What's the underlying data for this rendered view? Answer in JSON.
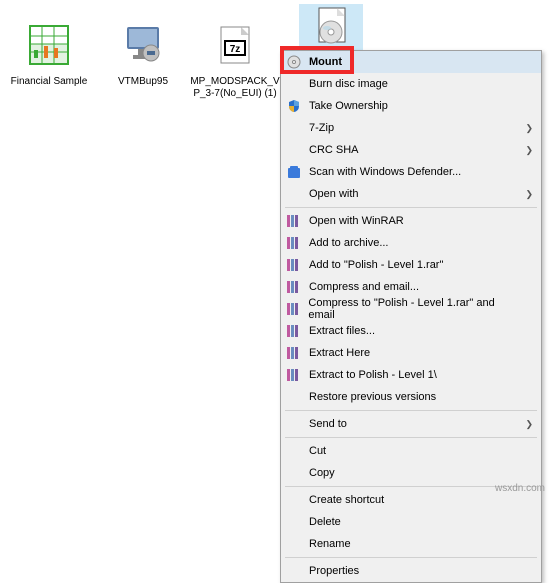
{
  "files": [
    {
      "label": "Financial Sample"
    },
    {
      "label": "VTMBup95"
    },
    {
      "label": "MP_MODSPACK_VP_3-7(No_EUI) (1)"
    },
    {
      "label": ""
    }
  ],
  "menu": {
    "mount": "Mount",
    "burn": "Burn disc image",
    "take_ownership": "Take Ownership",
    "seven_zip": "7-Zip",
    "crc_sha": "CRC SHA",
    "scan": "Scan with Windows Defender...",
    "open_with": "Open with",
    "open_winrar": "Open with WinRAR",
    "add_archive": "Add to archive...",
    "add_polish": "Add to \"Polish - Level 1.rar\"",
    "compress_email": "Compress and email...",
    "compress_polish_email": "Compress to \"Polish - Level 1.rar\" and email",
    "extract_files": "Extract files...",
    "extract_here": "Extract Here",
    "extract_polish": "Extract to Polish - Level 1\\",
    "restore": "Restore previous versions",
    "send_to": "Send to",
    "cut": "Cut",
    "copy": "Copy",
    "create_shortcut": "Create shortcut",
    "delete": "Delete",
    "rename": "Rename",
    "properties": "Properties"
  },
  "watermark": "wsxdn.com"
}
